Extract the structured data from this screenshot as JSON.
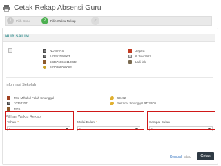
{
  "header": {
    "title": "Cetak Rekap Absensi Guru",
    "icon": "printer-icon"
  },
  "wizard": {
    "steps": [
      {
        "number": "1",
        "label": "Pilih Guru",
        "state": "done"
      },
      {
        "number": "2",
        "label": "Pilih Waktu Rekap",
        "state": "active"
      },
      {
        "number": "✓",
        "label": "",
        "state": "pending"
      }
    ]
  },
  "teacher": {
    "name": "NUR SALIM",
    "fields_left": [
      {
        "icon": "id-card-icon",
        "value": "NON-PNS"
      },
      {
        "icon": "id-card-icon",
        "value": "142353198063"
      },
      {
        "icon": "book-icon",
        "value": "6835760663110032"
      },
      {
        "icon": "badge-icon",
        "value": "6820806099063"
      }
    ],
    "fields_right": [
      {
        "icon": "map-flag-icon",
        "value": "Jepara"
      },
      {
        "icon": "calendar-icon",
        "value": "6 Juni 1962"
      },
      {
        "icon": "person-icon",
        "value": "Laki-laki"
      }
    ]
  },
  "school": {
    "section_title": "Informasi Sekolah",
    "fields_left": [
      {
        "icon": "school-icon",
        "value": "Mts. Miftahul Falah Smanggal"
      },
      {
        "icon": "id-card-icon",
        "value": "20364207"
      },
      {
        "icon": "book-icon",
        "value": "MTS"
      }
    ],
    "fields_right": [
      {
        "icon": "pin-icon",
        "value": "59452"
      },
      {
        "icon": "pin-icon",
        "value": "Sekacer Smanggal RT 38/06"
      }
    ]
  },
  "rekap": {
    "section_title": "Pilihan Waktu Rekap",
    "selects": [
      {
        "label": "Tahun",
        "required": "*",
        "value": "-"
      },
      {
        "label": "Mulai Bulan",
        "required": "*",
        "value": "-"
      },
      {
        "label": "Sampai Bulan",
        "required": "",
        "value": "-"
      }
    ]
  },
  "actions": {
    "back_label": "Kembali",
    "or_label": "atau",
    "print_label": "Cetak"
  },
  "colors": {
    "accent": "#4a9a9a",
    "step_active": "#4caf50",
    "highlight": "#d01818",
    "button": "#2f3a44"
  }
}
